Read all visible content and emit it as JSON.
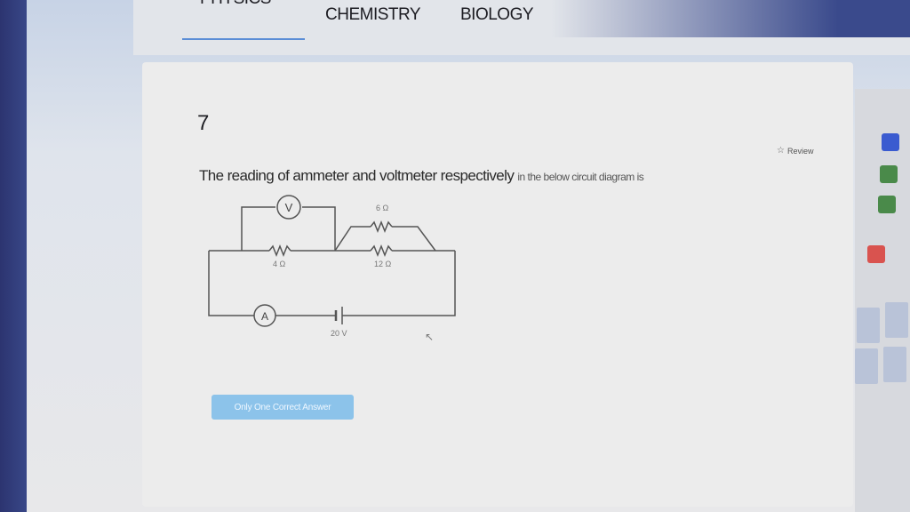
{
  "tabs": [
    {
      "label": "PHYSICS",
      "active": true
    },
    {
      "label": "CHEMISTRY",
      "active": false
    },
    {
      "label": "BIOLOGY",
      "active": false
    }
  ],
  "question": {
    "number": "7",
    "text_main": "The reading of ammeter and voltmeter respectively ",
    "text_tail": "in the below circuit diagram is",
    "review_label": "Review"
  },
  "circuit": {
    "voltmeter_symbol": "V",
    "ammeter_symbol": "A",
    "resistor_left_label": "4 Ω",
    "resistor_top_label": "6 Ω",
    "resistor_bottom_label": "12 Ω",
    "battery_label": "20 V"
  },
  "answer_type_badge": "Only One Correct Answer",
  "palette": {
    "accent": "#5b8dd6",
    "badge": "#8cc3ea",
    "palette_blue": "#3a5bd0",
    "palette_red": "#d9534f"
  }
}
